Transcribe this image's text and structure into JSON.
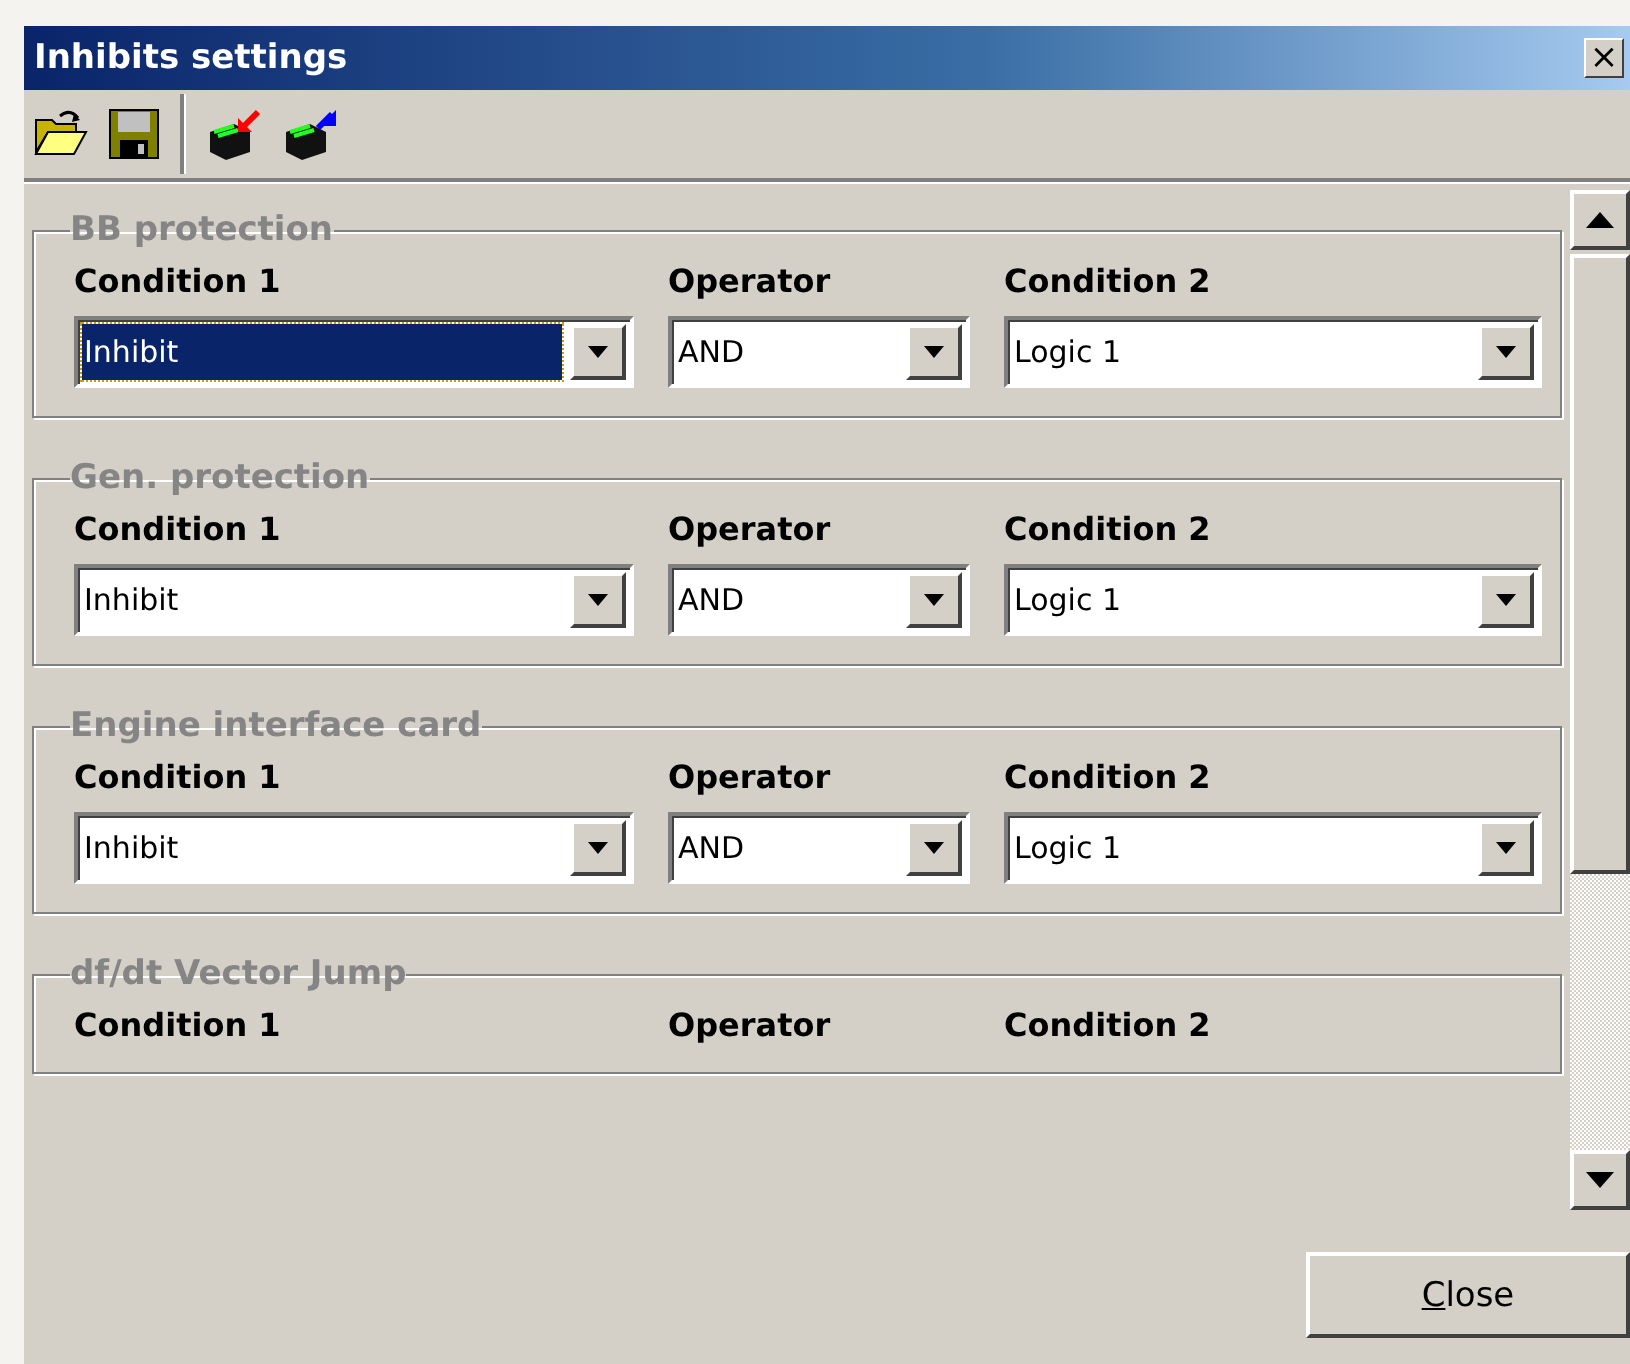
{
  "window": {
    "title": "Inhibits settings",
    "close_glyph": "×"
  },
  "toolbar": [
    {
      "kind": "open"
    },
    {
      "kind": "save"
    },
    {
      "kind": "separator"
    },
    {
      "kind": "import"
    },
    {
      "kind": "export"
    }
  ],
  "groups": [
    {
      "title": "BB protection",
      "fields": [
        {
          "label": "Condition 1",
          "value": "Inhibit",
          "focused": true
        },
        {
          "label": "Operator",
          "value": "AND",
          "focused": false
        },
        {
          "label": "Condition 2",
          "value": "Logic 1",
          "focused": false
        }
      ]
    },
    {
      "title": "Gen. protection",
      "fields": [
        {
          "label": "Condition 1",
          "value": "Inhibit",
          "focused": false
        },
        {
          "label": "Operator",
          "value": "AND",
          "focused": false
        },
        {
          "label": "Condition 2",
          "value": "Logic 1",
          "focused": false
        }
      ]
    },
    {
      "title": "Engine interface card",
      "fields": [
        {
          "label": "Condition 1",
          "value": "Inhibit",
          "focused": false
        },
        {
          "label": "Operator",
          "value": "AND",
          "focused": false
        },
        {
          "label": "Condition 2",
          "value": "Logic 1",
          "focused": false
        }
      ]
    },
    {
      "title": "df/dt Vector Jump",
      "fields": [
        {
          "label": "Condition 1"
        },
        {
          "label": "Operator"
        },
        {
          "label": "Condition 2"
        }
      ]
    }
  ],
  "buttons": [
    "Close"
  ]
}
